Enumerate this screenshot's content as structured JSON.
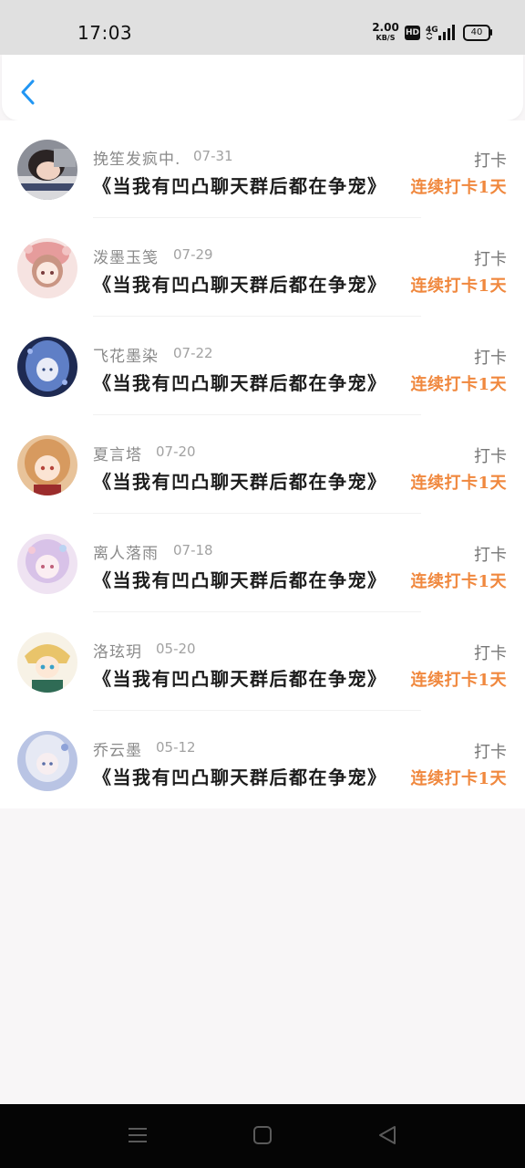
{
  "status_bar": {
    "time": "17:03",
    "net_speed_value": "2.00",
    "net_speed_unit": "KB/S",
    "hd_badge": "HD",
    "signal_label": "4G",
    "battery_level": "40",
    "icons": [
      "hd-icon",
      "signal-icon",
      "battery-icon"
    ]
  },
  "header": {
    "back_icon": "chevron-left-icon",
    "accent_color": "#2196f3"
  },
  "checkins": [
    {
      "user": "挽笙发疯中.",
      "date": "07-31",
      "title": "《当我有凹凸聊天群后都在争宠》",
      "action": "打卡",
      "streak": "连续打卡1天"
    },
    {
      "user": "泼墨玉笺",
      "date": "07-29",
      "title": "《当我有凹凸聊天群后都在争宠》",
      "action": "打卡",
      "streak": "连续打卡1天"
    },
    {
      "user": "飞花墨染",
      "date": "07-22",
      "title": "《当我有凹凸聊天群后都在争宠》",
      "action": "打卡",
      "streak": "连续打卡1天"
    },
    {
      "user": "夏言塔",
      "date": "07-20",
      "title": "《当我有凹凸聊天群后都在争宠》",
      "action": "打卡",
      "streak": "连续打卡1天"
    },
    {
      "user": "离人落雨",
      "date": "07-18",
      "title": "《当我有凹凸聊天群后都在争宠》",
      "action": "打卡",
      "streak": "连续打卡1天"
    },
    {
      "user": "洛玹玥",
      "date": "05-20",
      "title": "《当我有凹凸聊天群后都在争宠》",
      "action": "打卡",
      "streak": "连续打卡1天"
    },
    {
      "user": "乔云墨",
      "date": "05-12",
      "title": "《当我有凹凸聊天群后都在争宠》",
      "action": "打卡",
      "streak": "连续打卡1天"
    }
  ],
  "colors": {
    "streak": "#f0883e",
    "name": "#8a8a8a",
    "title": "#1c1c1c"
  },
  "nav_bar": {
    "icons": [
      "menu-icon",
      "home-icon",
      "back-triangle-icon"
    ]
  }
}
